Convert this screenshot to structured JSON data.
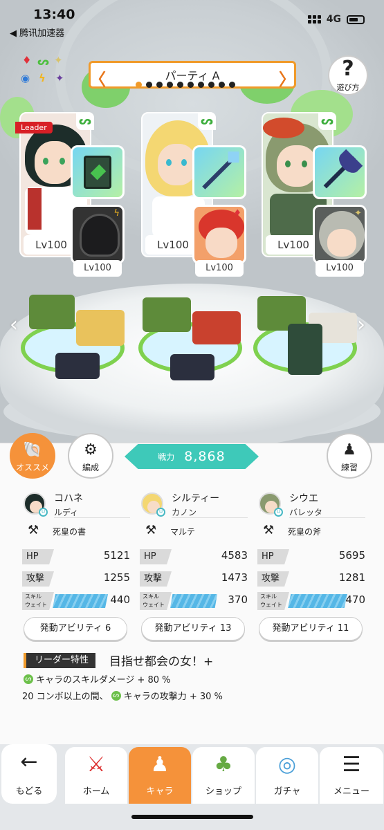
{
  "status_bar": {
    "time": "13:40",
    "back_app": "◀ 腾讯加速器",
    "network": "4G"
  },
  "party": {
    "title": "パーティ A",
    "page_count": 10,
    "active_page": 1
  },
  "help": {
    "label": "遊び方"
  },
  "cards": [
    {
      "leader": "Leader",
      "main_lv": "Lv100",
      "sub_lv": "Lv100",
      "attr": "wind",
      "sub_attr": "thunder"
    },
    {
      "leader": "",
      "main_lv": "Lv100",
      "sub_lv": "Lv100",
      "attr": "wind",
      "sub_attr": "fire"
    },
    {
      "leader": "",
      "main_lv": "Lv100",
      "sub_lv": "Lv100",
      "attr": "wind",
      "sub_attr": "light"
    }
  ],
  "buttons": {
    "osusume": "オススメ",
    "hensei": "編成",
    "renshu": "練習"
  },
  "power": {
    "label": "戦力",
    "value": "8,868"
  },
  "members": [
    {
      "name": "コハネ",
      "sub": "ルディ",
      "weapon": "死皇の書",
      "hp_label": "HP",
      "hp": "5121",
      "atk_label": "攻撃",
      "atk": "1255",
      "skill_label_1": "スキル",
      "skill_label_2": "ウェイト",
      "skill": "440",
      "skill_fill": 0.73,
      "ability": "発動アビリティ 6"
    },
    {
      "name": "シルティー",
      "sub": "カノン",
      "weapon": "マルテ",
      "hp_label": "HP",
      "hp": "4583",
      "atk_label": "攻撃",
      "atk": "1473",
      "skill_label_1": "スキル",
      "skill_label_2": "ウェイト",
      "skill": "370",
      "skill_fill": 0.62,
      "ability": "発動アビリティ 13"
    },
    {
      "name": "シウエ",
      "sub": "バレッタ",
      "weapon": "死皇の斧",
      "hp_label": "HP",
      "hp": "5695",
      "atk_label": "攻撃",
      "atk": "1281",
      "skill_label_1": "スキル",
      "skill_label_2": "ウェイト",
      "skill": "470",
      "skill_fill": 0.78,
      "ability": "発動アビリティ 11"
    }
  ],
  "leader_skill": {
    "tag": "リーダー特性",
    "name": "目指せ都会の女！+",
    "line1": "キャラのスキルダメージ + 80 %",
    "line2_prefix": "20 コンボ以上の間、",
    "line2_suffix": "キャラの攻撃力 + 30 %"
  },
  "nav": [
    {
      "label": "もどる",
      "icon": "back-arrow-icon"
    },
    {
      "label": "ホーム",
      "icon": "home-icon"
    },
    {
      "label": "キャラ",
      "icon": "character-icon",
      "active": true
    },
    {
      "label": "ショップ",
      "icon": "shop-icon"
    },
    {
      "label": "ガチャ",
      "icon": "gacha-icon"
    },
    {
      "label": "メニュー",
      "icon": "menu-icon"
    }
  ]
}
